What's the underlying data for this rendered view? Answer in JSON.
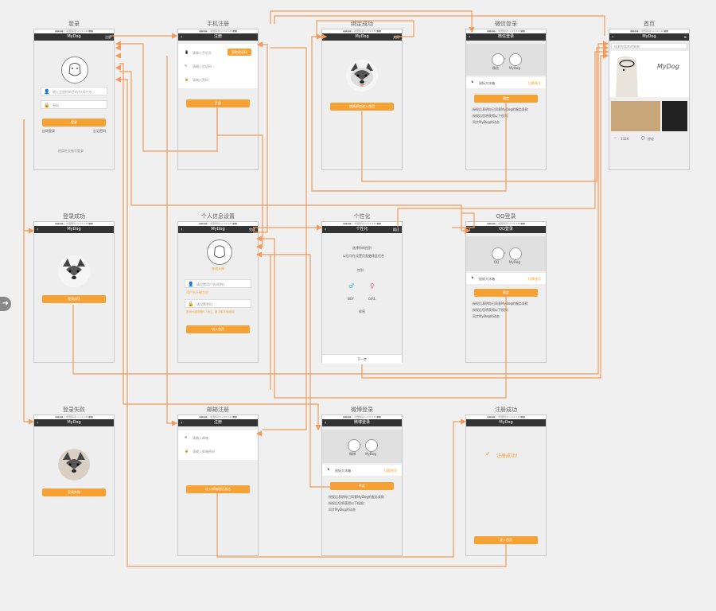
{
  "status_bar": "●●●●○ 中国移动   12:00 AM   ■■",
  "screens": {
    "login": {
      "title": "登录",
      "nav": "MyDog",
      "nav_right": "注册",
      "username_placeholder": "输入注册时的手机号/用户名",
      "password_placeholder": "密码",
      "login_button": "登录",
      "remember": "自动登录",
      "forgot": "忘记密码",
      "other_login": "使用社交账号登录"
    },
    "phone_register": {
      "title": "手机注册",
      "nav": "注册",
      "phone_placeholder": "请输入手机号",
      "code_button": "获取验证码",
      "code_placeholder": "请输入验证码",
      "password_placeholder": "请输入密码",
      "register_button": "注册"
    },
    "bind_success": {
      "title": "绑定成功",
      "nav": "MyDog",
      "nav_right": "关闭",
      "enter_button": "跳跃绑定进入首页"
    },
    "weibo_login": {
      "title": "微信登录",
      "nav": "微信登录",
      "left_label": "微信",
      "right_label": "MyDog",
      "account": "鼠标大冰箱",
      "switch_account": "切换账号",
      "confirm": "确定",
      "note": "授权后表明你已同意MyDog的服务条款",
      "note2": "授权后您将获得以下权限：",
      "check": "同步MyDog的动态"
    },
    "home": {
      "title": "首页",
      "nav": "MyDog",
      "search_placeholder": "搜索你喜欢的狗狗",
      "logo": "MyDog",
      "like_count": "1324",
      "comment_count": "评论"
    },
    "login_success": {
      "title": "登录成功",
      "nav": "MyDog",
      "button": "登录成功"
    },
    "profile": {
      "title": "个人信息设置",
      "nav": "MyDog",
      "nav_right": "完成",
      "avatar_note": "修改头像",
      "nickname_placeholder": "请设置用户名(昵称)",
      "nickname_hint": "用户名不能为空",
      "password_placeholder": "请设置密码",
      "password_hint": "密码长度须是6-16位，数字和字母组成",
      "enter_button": "进入首页"
    },
    "personalize": {
      "title": "个性化",
      "nav": "个性化",
      "nav_right": "跳过",
      "prompt1": "选择你的性别",
      "prompt2": "以后可在设置页面更改此信息",
      "gender_label": "性别",
      "boy": "BOY",
      "girl": "GIRL",
      "secret": "保密",
      "next": "下一步"
    },
    "qq_login": {
      "title": "QQ登录",
      "nav": "QQ登录",
      "left_label": "QQ",
      "right_label": "MyDog",
      "account": "鼠标大冰箱",
      "switch_account": "切换账号",
      "confirm": "确定",
      "note": "授权后表明你已同意MyDog的服务条款",
      "note2": "授权后您将获得以下权限：",
      "check": "同步MyDog的动态"
    },
    "login_fail": {
      "title": "登录失败",
      "nav": "MyDog",
      "button": "登录失败"
    },
    "email_register": {
      "title": "邮箱注册",
      "nav": "注册",
      "email_placeholder": "请输入邮箱",
      "password_placeholder": "请输入邮箱密码",
      "button": "进入邮箱验证激活"
    },
    "weibo_login2": {
      "title": "微博登录",
      "nav": "微博登录",
      "left_label": "微博",
      "right_label": "MyDog",
      "account": "鼠标大冰箱",
      "switch_account": "切换账号",
      "confirm": "确定",
      "note": "授权后表明你已同意MyDog的服务条款",
      "note2": "授权后您将获得以下权限：",
      "check": "同步MyDog的动态"
    },
    "register_success": {
      "title": "注册成功",
      "nav": "MyDog",
      "message": "注册成功！",
      "button": "进入首页"
    }
  },
  "colors": {
    "accent": "#f6a134",
    "navbar": "#333333",
    "connector": "#f39a5b"
  }
}
